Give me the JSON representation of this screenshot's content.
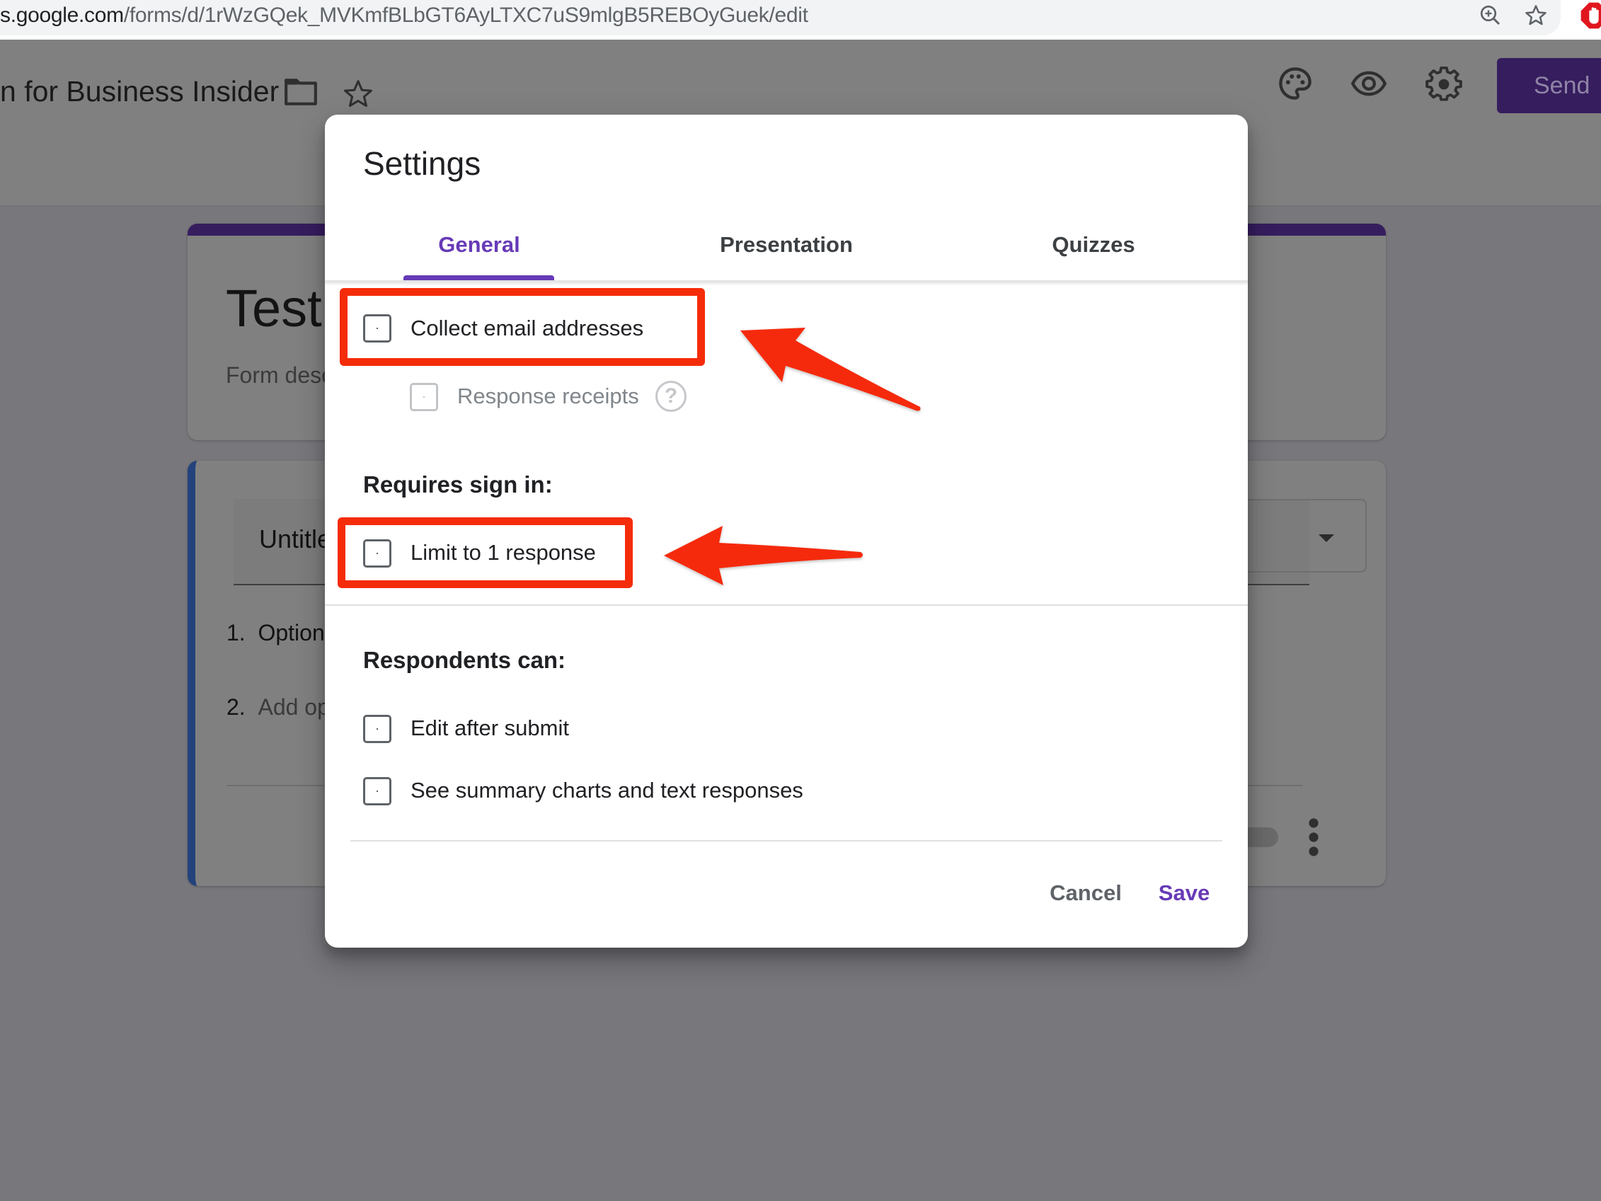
{
  "browser": {
    "url_host": "s.google.com",
    "url_path": "/forms/d/1rWzGQek_MVKmfBLbGT6AyLTXC7uS9mlgB5REBOyGuek/edit",
    "icons": [
      "zoom-icon",
      "bookmark-star-icon",
      "adblock-icon"
    ]
  },
  "header": {
    "form_title": "n for Business Insider",
    "icons": [
      "folder-icon",
      "star-icon",
      "palette-icon",
      "preview-eye-icon",
      "settings-gear-icon"
    ],
    "send_label": "Send"
  },
  "form": {
    "title": "Test",
    "description_placeholder": "Form desc",
    "question_title": "Untitle",
    "options": [
      {
        "num": "1.",
        "label": "Option"
      },
      {
        "num": "2.",
        "label": "Add op"
      }
    ]
  },
  "dialog": {
    "title": "Settings",
    "tabs": [
      {
        "label": "General",
        "active": true
      },
      {
        "label": "Presentation",
        "active": false
      },
      {
        "label": "Quizzes",
        "active": false
      }
    ],
    "collect_email": {
      "label": "Collect email addresses",
      "checked": false
    },
    "response_receipts": {
      "label": "Response receipts",
      "checked": false,
      "disabled": true,
      "help": "?"
    },
    "requires_sign_in": {
      "heading": "Requires sign in:",
      "limit_one": {
        "label": "Limit to 1 response",
        "checked": false
      }
    },
    "respondents_can": {
      "heading": "Respondents can:",
      "options": [
        {
          "label": "Edit after submit",
          "checked": false
        },
        {
          "label": "See summary charts and text responses",
          "checked": false
        }
      ]
    },
    "cancel_label": "Cancel",
    "save_label": "Save"
  },
  "colors": {
    "accent": "#673ab7",
    "annotation_red": "#f52c0a",
    "send_bg": "#361d5e",
    "question_border": "#24437c"
  }
}
